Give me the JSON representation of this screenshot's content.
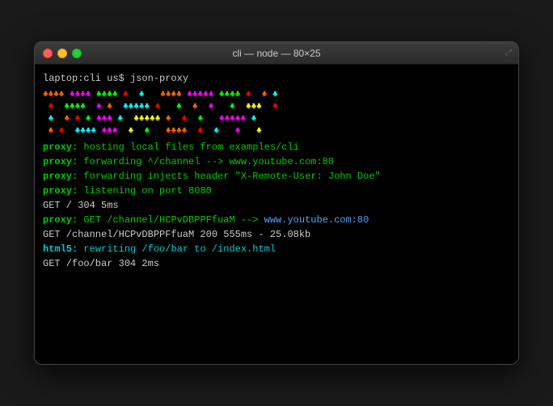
{
  "window": {
    "title": "cli — node — 80×25",
    "traffic_lights": [
      "red",
      "yellow",
      "green"
    ]
  },
  "terminal": {
    "command_line": "laptop:cli us$ json-proxy",
    "proxy_lines": [
      {
        "label": "proxy:",
        "text": " hosting local files from examples/cli"
      },
      {
        "label": "proxy:",
        "text": " forwarding ^/channel --> www.youtube.com:80"
      },
      {
        "label": "proxy:",
        "text": " forwarding injects header \"X-Remote-User: John Doe\""
      },
      {
        "label": "proxy:",
        "text": " listening on port 8080"
      }
    ],
    "get_line1": "GET / 304 5ms",
    "proxy_get_line": {
      "label": "proxy:",
      "text": " GET /channel/HCPvDBPPFfuaM --> ",
      "url": "www.youtube.com:80"
    },
    "get_line2": "GET /channel/HCPvDBPPFfuaM 200 555ms - 25.08kb",
    "html5_line": {
      "label": "html5:",
      "text": " rewriting /foo/bar to /index.html"
    },
    "get_line3": "GET /foo/bar 304 2ms"
  }
}
